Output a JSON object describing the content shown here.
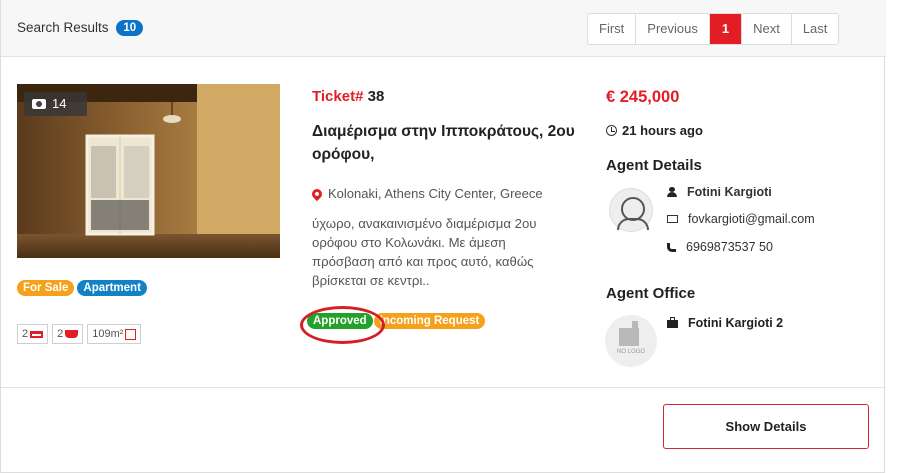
{
  "header": {
    "title": "Search Results",
    "count": "10"
  },
  "pagination": {
    "first": "First",
    "previous": "Previous",
    "current": "1",
    "next": "Next",
    "last": "Last"
  },
  "listing": {
    "photo_count": "14",
    "tags": [
      "For Sale",
      "Apartment"
    ],
    "features": {
      "bedrooms": "2",
      "bathrooms": "2",
      "area": "109m²"
    },
    "ticket_label": "Ticket#",
    "ticket_number": "38",
    "title": "Διαμέρισμα στην Ιπποκράτους, 2ου ορόφου,",
    "location": "Kolonaki, Athens City Center, Greece",
    "description": "ύχωρο, ανακαινισμένο διαμέρισμα 2ου ορόφου στο Κολωνάκι. Με άμεση πρόσβαση από και προς αυτό, καθώς βρίσκεται σε κεντρι..",
    "status_tags": [
      "Approved",
      "Incoming Request"
    ],
    "price": "€ 245,000",
    "time_ago": "21 hours ago"
  },
  "agent": {
    "heading": "Agent Details",
    "name": "Fotini Kargioti",
    "email": "fovkargioti@gmail.com",
    "phone": "6969873537 50"
  },
  "office": {
    "heading": "Agent Office",
    "logo_text": "NO LOGO",
    "name": "Fotini Kargioti 2"
  },
  "actions": {
    "show_details": "Show Details"
  },
  "colors": {
    "accent_red": "#e21d24",
    "badge_blue": "#0d73c9",
    "approved_green": "#23a12b",
    "orange_tag": "#f5a11b"
  }
}
